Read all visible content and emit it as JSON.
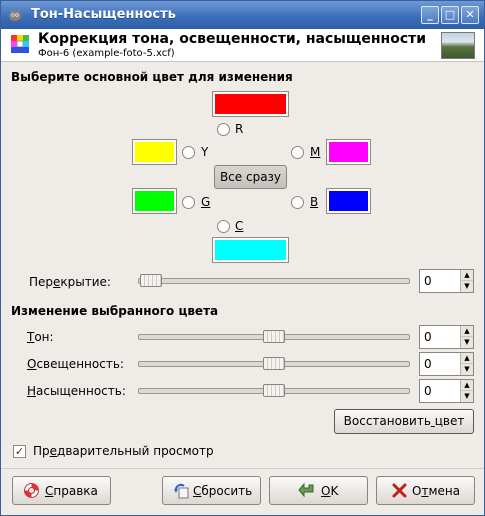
{
  "window": {
    "title": "Тон-Насыщенность",
    "controls": {
      "minimize": "_",
      "maximize": "□",
      "close": "✕"
    }
  },
  "header": {
    "title": "Коррекция тона, освещенности, насыщенности",
    "subtitle": "Фон-6 (example-foto-5.xcf)"
  },
  "primary_color_section": {
    "title": "Выберите основной цвет для изменения",
    "colors": {
      "R": {
        "label": "R",
        "color": "#ff0000"
      },
      "Y": {
        "label": "Y",
        "color": "#ffff00"
      },
      "M": {
        "label": "M",
        "color": "#ff00ff"
      },
      "G": {
        "label": "G",
        "color": "#00ff00"
      },
      "B": {
        "label": "B",
        "color": "#0000ff"
      },
      "C": {
        "label": "C",
        "color": "#00ffff"
      }
    },
    "all_button": "Все сразу",
    "overlap": {
      "label": "Перекрытие:",
      "value": "0",
      "fraction": 0.0
    }
  },
  "adjust_section": {
    "title": "Изменение выбранного цвета",
    "hue": {
      "label": "Тон:",
      "value": "0",
      "fraction": 0.5
    },
    "lightness": {
      "label": "Освещенность:",
      "value": "0",
      "fraction": 0.5
    },
    "saturation": {
      "label": "Насыщенность:",
      "value": "0",
      "fraction": 0.5
    },
    "reset_color": "Восстановить цвет"
  },
  "preview": {
    "label": "Предварительный просмотр",
    "checked": true
  },
  "buttons": {
    "help": "Справка",
    "reset": "Сбросить",
    "ok": "OK",
    "cancel": "Отмена"
  }
}
